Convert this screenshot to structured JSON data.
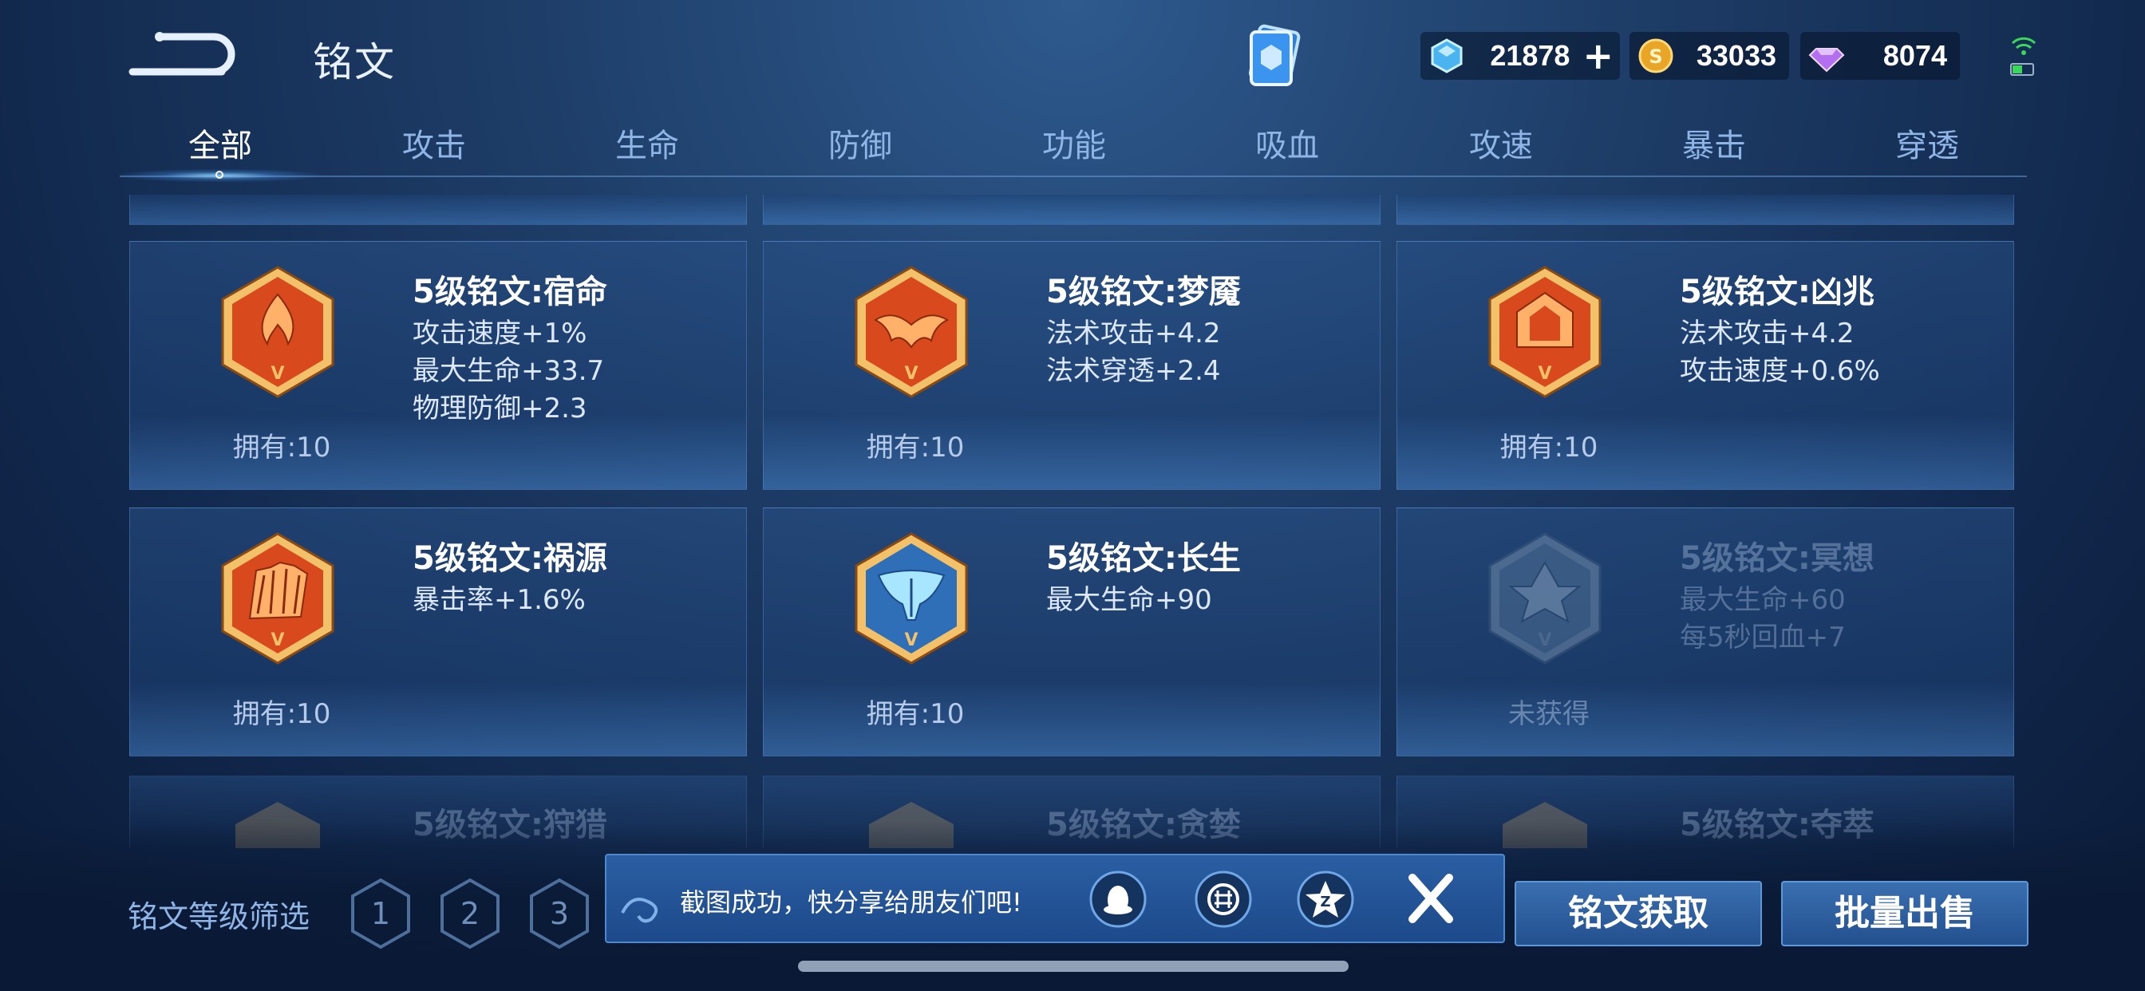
{
  "header": {
    "title": "铭文",
    "currencies": [
      {
        "icon": "ice-crystal-icon",
        "value": "21878"
      },
      {
        "icon": "gold-coin-icon",
        "value": "33033"
      },
      {
        "icon": "diamond-gem-icon",
        "value": "8074"
      }
    ]
  },
  "tabs": [
    {
      "label": "全部",
      "active": true
    },
    {
      "label": "攻击"
    },
    {
      "label": "生命"
    },
    {
      "label": "防御"
    },
    {
      "label": "功能"
    },
    {
      "label": "吸血"
    },
    {
      "label": "攻速"
    },
    {
      "label": "暴击"
    },
    {
      "label": "穿透"
    }
  ],
  "inscriptions": [
    {
      "name": "5级铭文:宿命",
      "stats": [
        "攻击速度+1%",
        "最大生命+33.7",
        "物理防御+2.3"
      ],
      "owned": "拥有:10",
      "color": "#d84a1e"
    },
    {
      "name": "5级铭文:梦魇",
      "stats": [
        "法术攻击+4.2",
        "法术穿透+2.4"
      ],
      "owned": "拥有:10",
      "color": "#d84a1e"
    },
    {
      "name": "5级铭文:凶兆",
      "stats": [
        "法术攻击+4.2",
        "攻击速度+0.6%"
      ],
      "owned": "拥有:10",
      "color": "#d84a1e"
    },
    {
      "name": "5级铭文:祸源",
      "stats": [
        "暴击率+1.6%"
      ],
      "owned": "拥有:10",
      "color": "#d84a1e"
    },
    {
      "name": "5级铭文:长生",
      "stats": [
        "最大生命+90"
      ],
      "owned": "拥有:10",
      "color": "#2f6fb8"
    },
    {
      "name": "5级铭文:冥想",
      "stats": [
        "最大生命+60",
        "每5秒回血+7"
      ],
      "owned": "未获得",
      "color": "#6a8aa8"
    }
  ],
  "next_row": [
    "5级铭文:狩猎",
    "5级铭文:贪婪",
    "5级铭文:夺萃"
  ],
  "filter": {
    "label": "铭文等级筛选",
    "levels": [
      "1",
      "2",
      "3"
    ]
  },
  "toast": {
    "message": "截图成功，快分享给朋友们吧!",
    "share_icons": [
      "qq-icon",
      "wechat-moments-icon",
      "qzone-icon"
    ]
  },
  "buttons": {
    "get": "铭文获取",
    "sell": "批量出售"
  }
}
